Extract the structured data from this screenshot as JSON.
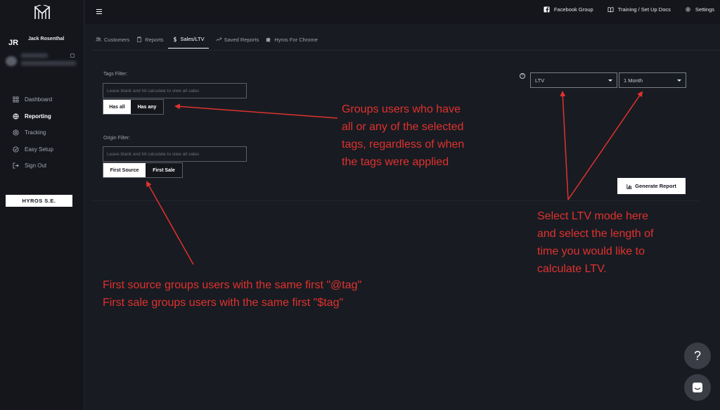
{
  "user": {
    "initials": "JR",
    "name": "Jack Rosenthal"
  },
  "sidebar": {
    "items": [
      {
        "label": "Dashboard",
        "icon": "grid-icon"
      },
      {
        "label": "Reporting",
        "icon": "globe-icon",
        "active": true
      },
      {
        "label": "Tracking",
        "icon": "target-icon"
      },
      {
        "label": "Easy Setup",
        "icon": "check-circle-icon"
      },
      {
        "label": "Sign Out",
        "icon": "sign-out-icon"
      }
    ],
    "hyros_button": "HYROS S.E."
  },
  "topbar": {
    "links": [
      {
        "label": "Facebook Group",
        "icon": "facebook-icon"
      },
      {
        "label": "Training / Set Up Docs",
        "icon": "book-icon"
      },
      {
        "label": "Settings",
        "icon": "gear-icon"
      }
    ]
  },
  "tabs": [
    {
      "label": "Customers",
      "icon": "users-icon"
    },
    {
      "label": "Reports",
      "icon": "clipboard-icon"
    },
    {
      "label": "Sales/LTV",
      "icon": "dollar-icon",
      "active": true
    },
    {
      "label": "Saved Reports",
      "icon": "trend-icon"
    },
    {
      "label": "Hyros For Chrome",
      "icon": "puzzle-icon"
    }
  ],
  "tags_filter": {
    "label": "Tags Filter:",
    "placeholder": "Leave blank and hit calculate to view all sales",
    "value": "",
    "options": [
      "Has all",
      "Has any"
    ],
    "selected": "Has all"
  },
  "origin_filter": {
    "label": "Origin Filter:",
    "placeholder": "Leave blank and hit calculate to view all sales",
    "value": "",
    "options": [
      "First Source",
      "First Sale"
    ],
    "selected": "First Source"
  },
  "mode_select": {
    "value": "LTV"
  },
  "period_select": {
    "value": "1 Month"
  },
  "generate_button": "Generate Report",
  "help_glyph": "?",
  "annotations": {
    "tags": [
      "Groups users who have",
      "all or any of the selected",
      "tags, regardless of when",
      "the tags were applied"
    ],
    "origin": [
      "First source groups users with the same first \"@tag\"",
      "First sale groups users with the same first \"$tag\""
    ],
    "ltv": [
      "Select LTV mode here",
      "and select the length of",
      "time you would like to",
      "calculate LTV."
    ]
  },
  "colors": {
    "annotation": "#e0322e",
    "background": "#181b22",
    "sidebar": "#14161c"
  }
}
